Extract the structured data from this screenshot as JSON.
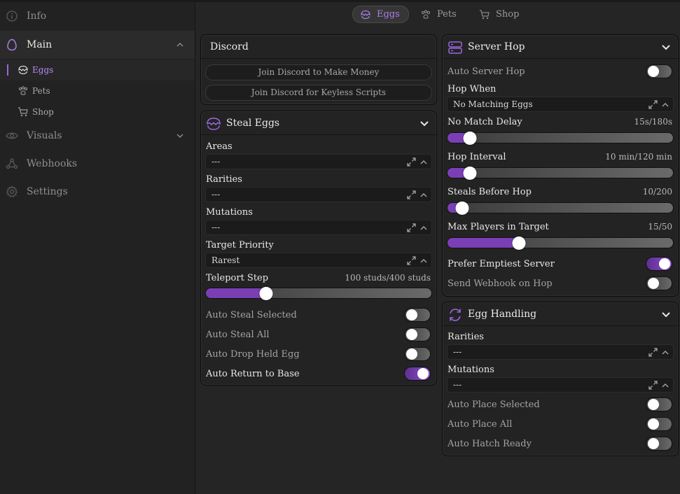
{
  "sidebar": {
    "items": [
      {
        "label": "Info",
        "icon": "info-icon"
      },
      {
        "label": "Main",
        "icon": "egg-icon"
      },
      {
        "label": "Visuals",
        "icon": "eye-icon"
      },
      {
        "label": "Webhooks",
        "icon": "webhook-icon"
      },
      {
        "label": "Settings",
        "icon": "gear-icon"
      }
    ],
    "sub_items": [
      {
        "label": "Eggs",
        "icon": "egg-crack-icon"
      },
      {
        "label": "Pets",
        "icon": "paw-icon"
      },
      {
        "label": "Shop",
        "icon": "cart-icon"
      }
    ]
  },
  "tabs": [
    {
      "label": "Eggs",
      "icon": "egg-crack-icon"
    },
    {
      "label": "Pets",
      "icon": "paw-icon"
    },
    {
      "label": "Shop",
      "icon": "cart-icon"
    }
  ],
  "discord": {
    "title": "Discord",
    "btn1": "Join Discord to Make Money",
    "btn2": "Join Discord for Keyless Scripts"
  },
  "steal": {
    "title": "Steal Eggs",
    "areas_label": "Areas",
    "areas_value": "---",
    "rarities_label": "Rarities",
    "rarities_value": "---",
    "mutations_label": "Mutations",
    "mutations_value": "---",
    "priority_label": "Target Priority",
    "priority_value": "Rarest",
    "teleport_label": "Teleport Step",
    "teleport_value": "100 studs/400 studs",
    "teleport_fraction": 0.25,
    "toggles": [
      {
        "label": "Auto Steal Selected",
        "on": false
      },
      {
        "label": "Auto Steal All",
        "on": false
      },
      {
        "label": "Auto Drop Held Egg",
        "on": false
      },
      {
        "label": "Auto Return to Base",
        "on": true
      }
    ]
  },
  "hop": {
    "title": "Server Hop",
    "auto_label": "Auto Server Hop",
    "auto_on": false,
    "when_label": "Hop When",
    "when_value": "No Matching Eggs",
    "sliders": [
      {
        "label": "No Match Delay",
        "value": "15s/180s",
        "fraction": 0.083
      },
      {
        "label": "Hop Interval",
        "value": "10 min/120 min",
        "fraction": 0.083
      },
      {
        "label": "Steals Before Hop",
        "value": "10/200",
        "fraction": 0.05
      },
      {
        "label": "Max Players in Target",
        "value": "15/50",
        "fraction": 0.3
      }
    ],
    "prefer_label": "Prefer Emptiest Server",
    "prefer_on": true,
    "webhook_label": "Send Webhook on Hop",
    "webhook_on": false
  },
  "handling": {
    "title": "Egg Handling",
    "rarities_label": "Rarities",
    "rarities_value": "---",
    "mutations_label": "Mutations",
    "mutations_value": "---",
    "toggles": [
      {
        "label": "Auto Place Selected",
        "on": false
      },
      {
        "label": "Auto Place All",
        "on": false
      },
      {
        "label": "Auto Hatch Ready",
        "on": false
      }
    ]
  },
  "colors": {
    "accent": "#9b66e0",
    "bg": "#252525"
  }
}
